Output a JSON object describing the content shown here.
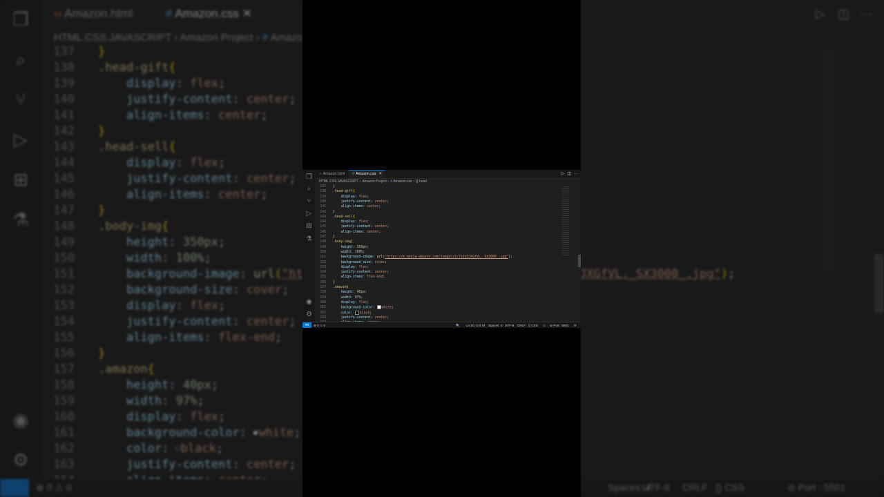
{
  "tabs": [
    {
      "label": "Amazon.html",
      "type": "html",
      "active": false
    },
    {
      "label": "Amazon.css",
      "type": "css",
      "active": true
    }
  ],
  "breadcrumb": [
    "HTML.CSS.JAVASCRIPT",
    "Amazon Project",
    "Amazon.css",
    "head"
  ],
  "icons": {
    "explorer": "files-icon",
    "search": "search-icon",
    "scm": "source-control-icon",
    "run": "run-debug-icon",
    "extensions": "extensions-icon",
    "testing": "beaker-icon",
    "account": "account-icon",
    "settings": "gear-icon",
    "close": "close-icon",
    "play": "play-icon",
    "split": "split-editor-icon",
    "more": "more-icon"
  },
  "code": [
    {
      "n": "137",
      "t": "}"
    },
    {
      "n": "138",
      "t": ".head-gift{"
    },
    {
      "n": "139",
      "t": "    display: flex;"
    },
    {
      "n": "140",
      "t": "    justify-content: center;"
    },
    {
      "n": "141",
      "t": "    align-items: center;"
    },
    {
      "n": "142",
      "t": "}"
    },
    {
      "n": "143",
      "t": ".head-sell{"
    },
    {
      "n": "144",
      "t": "    display: flex;"
    },
    {
      "n": "145",
      "t": "    justify-content: center;"
    },
    {
      "n": "146",
      "t": "    align-items: center;"
    },
    {
      "n": "147",
      "t": "}"
    },
    {
      "n": "148",
      "t": ".body-img{"
    },
    {
      "n": "149",
      "t": "    height: 350px;"
    },
    {
      "n": "150",
      "t": "    width: 100%;"
    },
    {
      "n": "151",
      "t": "    background-image: url(\"https://m.media-amazon.com/images/I/71Ie3JXGfVL._SX3000_.jpg\");"
    },
    {
      "n": "152",
      "t": "    background-size: cover;"
    },
    {
      "n": "153",
      "t": "    display: flex;"
    },
    {
      "n": "154",
      "t": "    justify-content: center;"
    },
    {
      "n": "155",
      "t": "    align-items: flex-end;"
    },
    {
      "n": "156",
      "t": "}"
    },
    {
      "n": "157",
      "t": ".amazon{"
    },
    {
      "n": "158",
      "t": "    height: 40px;"
    },
    {
      "n": "159",
      "t": "    width: 97%;"
    },
    {
      "n": "160",
      "t": "    display: flex;"
    },
    {
      "n": "161",
      "t": "    background-color: white;"
    },
    {
      "n": "162",
      "t": "    color: black;"
    },
    {
      "n": "163",
      "t": "    justify-content: center;"
    },
    {
      "n": "164",
      "t": "    align-items: center;"
    }
  ],
  "status": {
    "errors": "0",
    "warnings": "0",
    "position": "Ln 10, Col 18",
    "spaces": "Spaces: 4",
    "encoding": "UTF-8",
    "eol": "CRLF",
    "language": "CSS",
    "port": "Port : 5501"
  },
  "colors": {
    "editor_bg": "#1f1f1f",
    "accent": "#0078d4",
    "selector": "#d7ba7d",
    "property": "#9cdcfe",
    "value": "#ce9178",
    "number": "#b5cea8"
  }
}
